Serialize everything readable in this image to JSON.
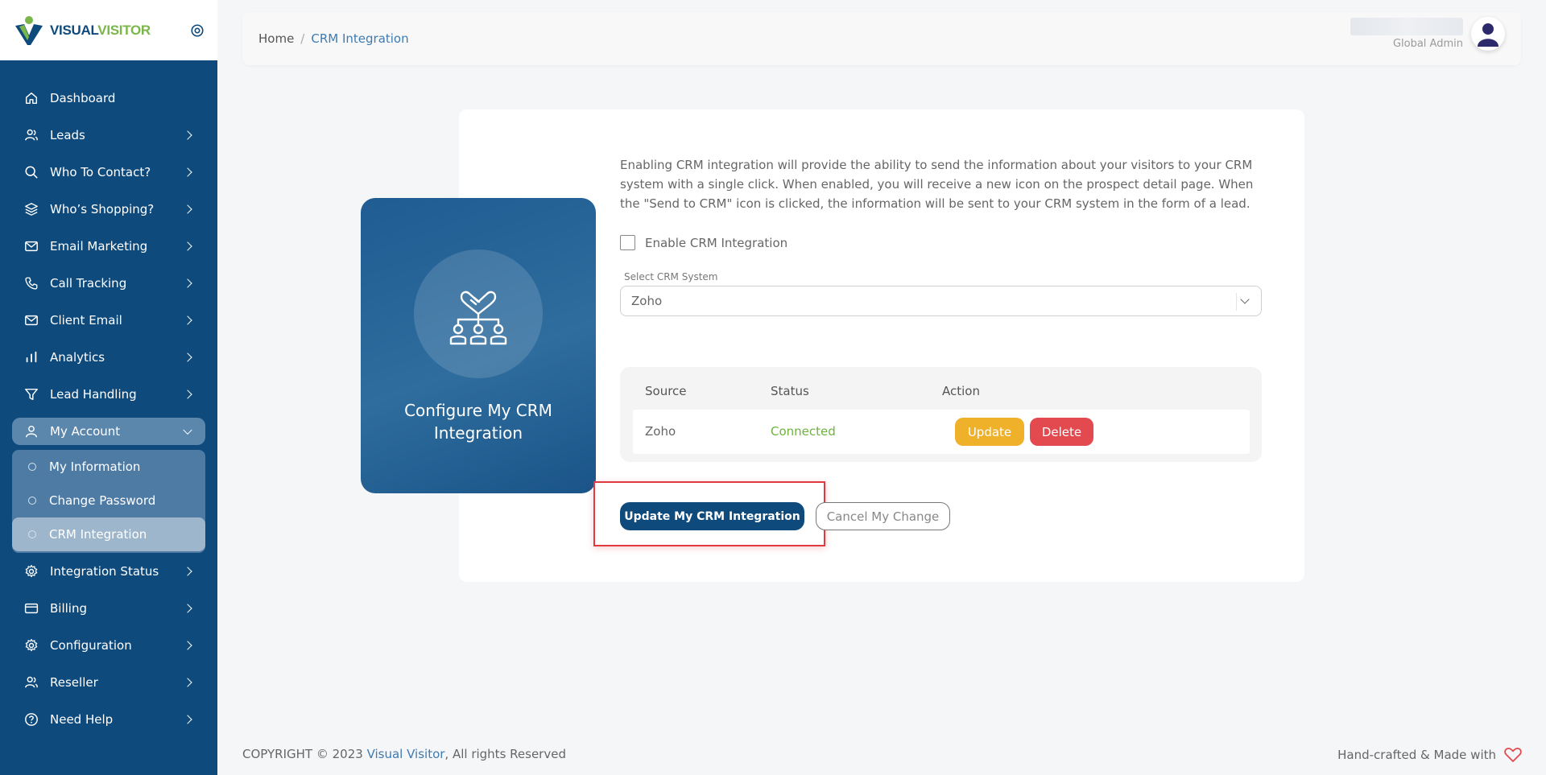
{
  "brand": {
    "part1": "VISUAL",
    "part2": "VISITOR",
    "accent_blue": "#0e4a7c",
    "accent_green": "#7ab648"
  },
  "sidebar": {
    "items": [
      {
        "label": "Dashboard",
        "icon": "home-icon",
        "has_chevron": false
      },
      {
        "label": "Leads",
        "icon": "users-icon",
        "has_chevron": true
      },
      {
        "label": "Who To Contact?",
        "icon": "search-icon",
        "has_chevron": true
      },
      {
        "label": "Who’s Shopping?",
        "icon": "layers-icon",
        "has_chevron": true
      },
      {
        "label": "Email Marketing",
        "icon": "mail-icon",
        "has_chevron": true
      },
      {
        "label": "Call Tracking",
        "icon": "phone-icon",
        "has_chevron": true
      },
      {
        "label": "Client Email",
        "icon": "mail-icon",
        "has_chevron": true
      },
      {
        "label": "Analytics",
        "icon": "bar-chart-icon",
        "has_chevron": true
      },
      {
        "label": "Lead Handling",
        "icon": "filter-icon",
        "has_chevron": true
      },
      {
        "label": "My Account",
        "icon": "user-icon",
        "has_chevron": true,
        "open": true
      },
      {
        "label": "Integration Status",
        "icon": "gear-icon",
        "has_chevron": true
      },
      {
        "label": "Billing",
        "icon": "credit-card-icon",
        "has_chevron": true
      },
      {
        "label": "Configuration",
        "icon": "gear-icon",
        "has_chevron": true
      },
      {
        "label": "Reseller",
        "icon": "users-icon",
        "has_chevron": true
      },
      {
        "label": "Need Help",
        "icon": "help-circle-icon",
        "has_chevron": true
      }
    ],
    "submenu": [
      {
        "label": "My Information"
      },
      {
        "label": "Change Password"
      },
      {
        "label": "CRM Integration",
        "active": true
      }
    ]
  },
  "header": {
    "breadcrumb": {
      "home": "Home",
      "separator": "/",
      "current": "CRM Integration"
    },
    "user": {
      "role": "Global Admin"
    }
  },
  "main": {
    "panel_title": "Configure My CRM Integration",
    "description": "Enabling CRM integration will provide the ability to send the information about your visitors to your CRM system with a single click. When enabled, you will receive a new icon on the prospect detail page. When the \"Send to CRM\" icon is clicked, the information will be sent to your CRM system in the form of a lead.",
    "enable_label": "Enable CRM Integration",
    "enable_checked": false,
    "select_label": "Select CRM System",
    "select_value": "Zoho",
    "table": {
      "headers": [
        "Source",
        "Status",
        "Action"
      ],
      "row": {
        "source": "Zoho",
        "status": "Connected",
        "status_color": "#6db33f",
        "update_label": "Update",
        "delete_label": "Delete"
      }
    },
    "primary_button": "Update My CRM Integration",
    "cancel_button": "Cancel My Change"
  },
  "footer": {
    "copyright_prefix": "COPYRIGHT © 2023 ",
    "company": "Visual Visitor",
    "copyright_suffix": ", All rights Reserved",
    "made_with": "Hand-crafted & Made with"
  }
}
